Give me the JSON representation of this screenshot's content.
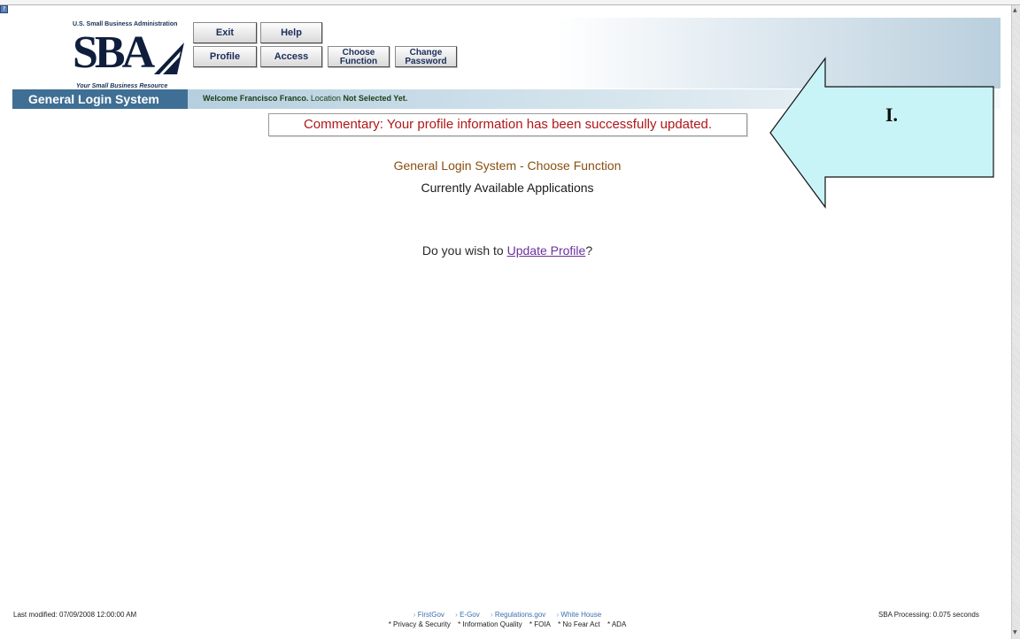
{
  "header": {
    "logo_top": "U.S. Small Business Administration",
    "logo_main": "SBA",
    "logo_tagline": "Your Small Business Resource",
    "buttons": {
      "exit": "Exit",
      "help": "Help",
      "profile": "Profile",
      "access": "Access",
      "choose_function": "Choose\nFunction",
      "change_password": "Change\nPassword"
    }
  },
  "nav_bar": {
    "system_title": "General Login System",
    "welcome_prefix": "Welcome Francisco Franco.",
    "location_label": "Location",
    "location_value": "Not Selected Yet."
  },
  "main": {
    "commentary": "Commentary: Your profile information has been successfully updated.",
    "function_title": "General Login System - Choose Function",
    "apps_title": "Currently Available Applications",
    "update_prefix": "Do you wish to ",
    "update_link": "Update Profile",
    "update_suffix": "?"
  },
  "annotation": {
    "label": "I.",
    "fill_color": "#c8f4f8",
    "stroke_color": "#111111"
  },
  "footer": {
    "last_modified": "Last modified: 07/09/2008 12:00:00 AM",
    "processing": "SBA Processing:  0.075 seconds",
    "links": [
      "FirstGov",
      "E-Gov",
      "Regulations.gov",
      "White House"
    ],
    "sub_links": [
      "* Privacy & Security",
      "* Information Quality",
      "* FOIA",
      "* No Fear Act",
      "* ADA"
    ]
  },
  "colors": {
    "system_title_bg": "#3f6f94",
    "commentary_text": "#b01717",
    "function_title": "#8a4f10",
    "link": "#6b2fa0"
  }
}
